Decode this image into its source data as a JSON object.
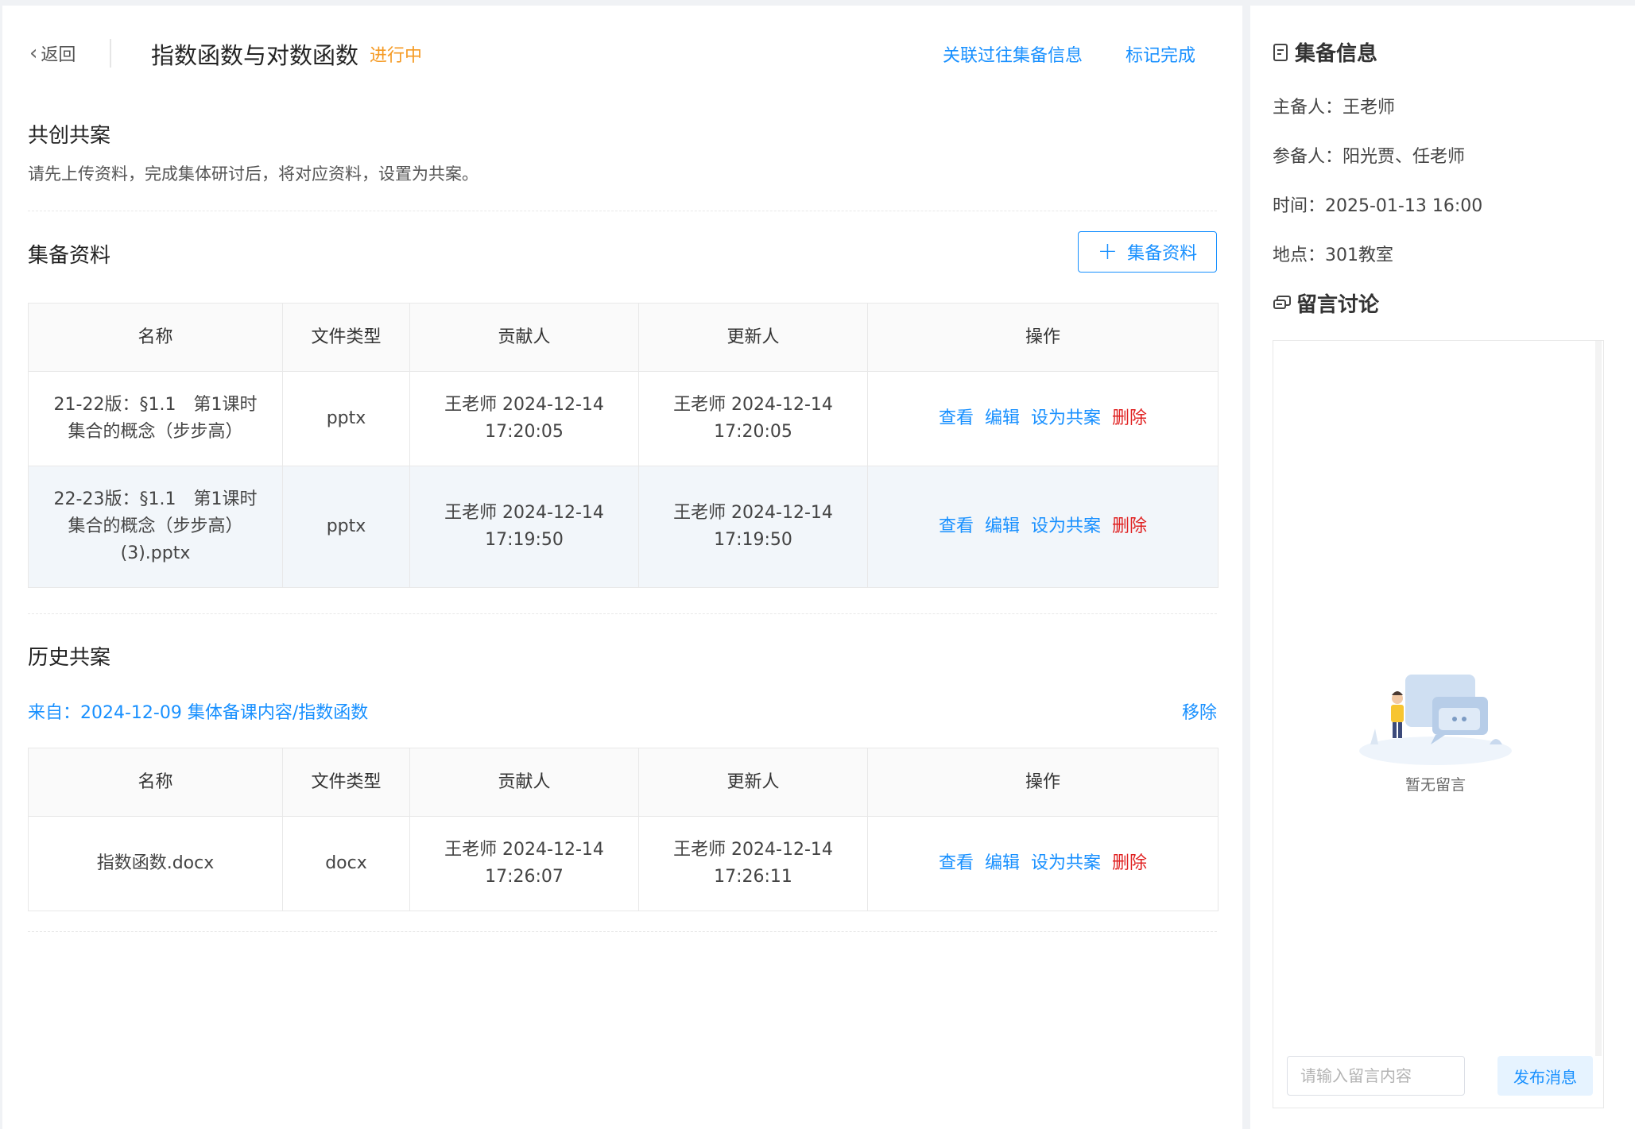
{
  "header": {
    "back_label": "返回",
    "title": "指数函数与对数函数",
    "status": "进行中",
    "link_associate": "关联过往集备信息",
    "link_mark_done": "标记完成"
  },
  "shared_plan": {
    "title": "共创共案",
    "desc": "请先上传资料，完成集体研讨后，将对应资料，设置为共案。"
  },
  "materials": {
    "title": "集备资料",
    "add_button": "集备资料",
    "columns": [
      "名称",
      "文件类型",
      "贡献人",
      "更新人",
      "操作"
    ],
    "rows": [
      {
        "name": "21-22版：§1.1　第1课时集合的概念（步步高）",
        "type": "pptx",
        "contributor": "王老师 2024-12-14 17:20:05",
        "updater": "王老师 2024-12-14 17:20:05"
      },
      {
        "name": "22-23版：§1.1　第1课时集合的概念（步步高）(3).pptx",
        "type": "pptx",
        "contributor": "王老师 2024-12-14 17:19:50",
        "updater": "王老师 2024-12-14 17:19:50"
      }
    ],
    "ops": {
      "view": "查看",
      "edit": "编辑",
      "set_shared": "设为共案",
      "delete": "删除"
    }
  },
  "history": {
    "title": "历史共案",
    "from_link": "来自：2024-12-09 集体备课内容/指数函数",
    "remove": "移除",
    "columns": [
      "名称",
      "文件类型",
      "贡献人",
      "更新人",
      "操作"
    ],
    "rows": [
      {
        "name": "指数函数.docx",
        "type": "docx",
        "contributor": "王老师 2024-12-14 17:26:07",
        "updater": "王老师 2024-12-14 17:26:11"
      }
    ],
    "ops": {
      "view": "查看",
      "edit": "编辑",
      "set_shared": "设为共案",
      "delete": "删除"
    }
  },
  "sidebar": {
    "info_title": "集备信息",
    "host": "主备人：王老师",
    "participants": "参备人：阳光贾、任老师",
    "time": "时间：2025-01-13 16:00",
    "location": "地点：301教室",
    "discussion_title": "留言讨论",
    "empty_text": "暂无留言",
    "input_placeholder": "请输入留言内容",
    "send_button": "发布消息"
  },
  "colors": {
    "accent": "#1890ff",
    "status": "#f59a23",
    "danger": "#e02020"
  }
}
